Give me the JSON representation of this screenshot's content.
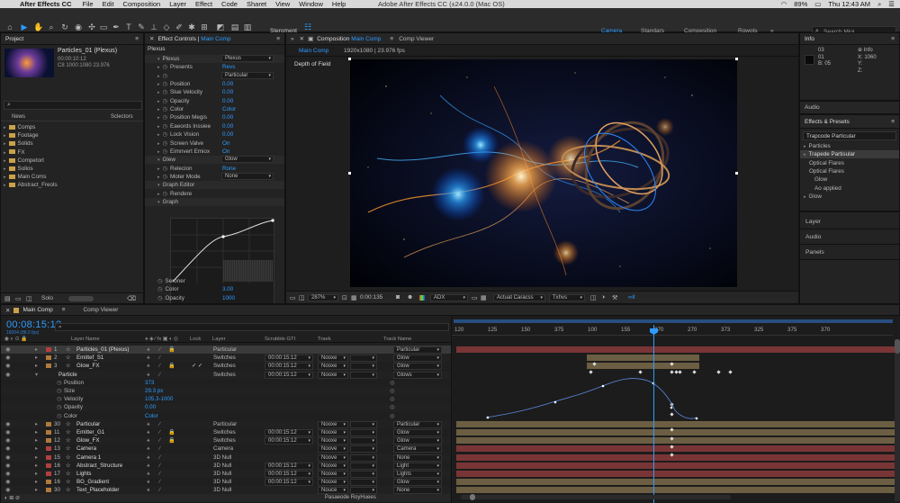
{
  "menubar": {
    "app": "After Effects CC",
    "items": [
      "File",
      "Edit",
      "Composition",
      "Layer",
      "Effect",
      "Code",
      "Sharet",
      "View",
      "Window",
      "Help"
    ],
    "center": "Adobe After Effects CC (±24.0.0 (Mac OS)",
    "battery": "89%",
    "clock": "Thu 12:43 AM"
  },
  "toolbar": {
    "storement": "Steroment",
    "workspaces": [
      "Camera",
      "Standars",
      "Compesition",
      "Rowots"
    ],
    "search": "Search Mioi"
  },
  "project": {
    "title": "Project",
    "comp_name": "Particles_01 (Plexus)",
    "comp_dur": "00:00:10:12",
    "comp_size": "C8 1000:1080 23.976",
    "col_name": "News",
    "col_sel": "Sclectors",
    "items": [
      "Comps",
      "Footage",
      "Solids",
      "FX",
      "Competort",
      "Solios",
      "Main Coms",
      "Abstract_Freols"
    ],
    "bottom_label": "Solo"
  },
  "effects": {
    "tab": "Effect Controls",
    "tab_comp": "Main Comp",
    "layer": "Plexus",
    "rows": [
      {
        "l": "Plexus",
        "v": "Plexus",
        "dd": true,
        "indent": 0
      },
      {
        "l": "Presents",
        "v": "Revs",
        "indent": 1
      },
      {
        "l": "",
        "v": "Particular",
        "dd": true,
        "indent": 1
      },
      {
        "l": "Position",
        "v": "0.00",
        "indent": 1
      },
      {
        "l": "Slue Velocity",
        "v": "0.00",
        "indent": 1
      },
      {
        "l": "Opacity",
        "v": "0.00",
        "indent": 1
      },
      {
        "l": "Color",
        "v": "Color",
        "indent": 1
      },
      {
        "l": "Position Megis",
        "v": "0.00",
        "indent": 1
      },
      {
        "l": "Eaeords Inssiee",
        "v": "0.00",
        "indent": 1
      },
      {
        "l": "Lock Vision",
        "v": "0.00",
        "indent": 1
      },
      {
        "l": "Screen Valve",
        "v": "On",
        "indent": 1
      },
      {
        "l": "Eimnvert Emiox",
        "v": "On",
        "indent": 1
      },
      {
        "l": "Glew",
        "v": "Glow",
        "dd": true,
        "indent": 0
      },
      {
        "l": "Relecion",
        "v": "Rone",
        "indent": 1
      },
      {
        "l": "Moter Mode",
        "v": "None",
        "dd": true,
        "indent": 1
      },
      {
        "l": "Graph Editor",
        "v": "",
        "indent": 0
      },
      {
        "l": "Rendere",
        "v": "",
        "indent": 1
      },
      {
        "l": "Graph",
        "v": "",
        "indent": 0
      }
    ],
    "bottom": [
      {
        "l": "Seroner",
        "v": ""
      },
      {
        "l": "Color",
        "v": "3.00"
      },
      {
        "l": "Opacity",
        "v": "1000"
      }
    ]
  },
  "comp": {
    "tab": "Composition",
    "tab_name": "Main Comp",
    "tab2": "Comp Viewer",
    "sub_tab": "Main Comp",
    "res": "1920x1080 | 23.976 fps",
    "label": "Depth of Field",
    "zoom": "287%",
    "time": "0:00:135",
    "mode": "ADX",
    "view": "Actuat Caracss",
    "views": "Txhvs",
    "extra": "∞ll"
  },
  "info": {
    "title": "Info",
    "r": "03",
    "g": "01",
    "b": "05",
    "x_label": "Info",
    "x": "1060",
    "y": "",
    "z": ""
  },
  "audio_title": "Audio",
  "presets": {
    "title": "Effects & Presets",
    "search": "Trapcode Particular",
    "items": [
      {
        "l": "Particles",
        "i": 0
      },
      {
        "l": "Trapede Partisular",
        "i": 0,
        "sel": true
      },
      {
        "l": "Optical Flares",
        "i": 1
      },
      {
        "l": "Optical Flares",
        "i": 1
      },
      {
        "l": "Glow",
        "i": 2
      },
      {
        "l": "Ao applied",
        "i": 2
      },
      {
        "l": "Glow",
        "i": 0
      }
    ]
  },
  "side_panels": [
    "Layer",
    "Audio",
    "Panels"
  ],
  "timeline": {
    "tab": "Main Comp",
    "tab2": "Comp Viewer",
    "timecode": "00:08:15:12",
    "fps": "16004 (88.0 fps)",
    "cols": [
      "Layer Name",
      "Lock",
      "Layer",
      "Scrubble GTI",
      "Traek",
      "Track Name"
    ],
    "ruler": [
      "120",
      "125",
      "150",
      "375",
      "100",
      "155",
      "370",
      "270",
      "373",
      "325",
      "375",
      "370"
    ],
    "layers": [
      {
        "n": "1",
        "name": "Particles_01 (Plexus)",
        "layer": "Particular",
        "time": "",
        "trk": "",
        "tn": "Particular",
        "color": "#b04040",
        "sel": true
      },
      {
        "n": "2",
        "name": "Emittef_S1",
        "layer": "Switches",
        "time": "00:00:15:12",
        "trk": "Nooxe",
        "tn": "Glow",
        "color": "#b07a3a"
      },
      {
        "n": "3",
        "name": "Glow_FX",
        "layer": "Switches",
        "time": "00:00:15:12",
        "trk": "Nooxe",
        "tn": "Glow",
        "color": "#b07a3a"
      },
      {
        "n": "",
        "name": "Particle",
        "layer": "Switches",
        "time": "00:00:15:12",
        "trk": "Nooxe",
        "tn": "Glows",
        "color": "",
        "sub": true
      },
      {
        "n": "",
        "name": "Position",
        "val": "373",
        "prop": true
      },
      {
        "n": "",
        "name": "Size",
        "val": "29.3 px",
        "prop": true
      },
      {
        "n": "",
        "name": "Velocity",
        "val": "105.3-1000",
        "prop": true
      },
      {
        "n": "",
        "name": "Opavity",
        "val": "0.00",
        "prop": true
      },
      {
        "n": "",
        "name": "Color",
        "val": "Color",
        "prop": true
      },
      {
        "n": "30",
        "name": "Particular",
        "layer": "Particular",
        "time": "",
        "trk": "Nooxe",
        "tn": "Particular",
        "color": "#b07a3a"
      },
      {
        "n": "11",
        "name": "Emitter_G1",
        "layer": "Switches",
        "time": "00:00:15:12",
        "trk": "Nooxe",
        "tn": "Glow",
        "color": "#b07a3a"
      },
      {
        "n": "12",
        "name": "Glow_FX",
        "layer": "Switches",
        "time": "00:00:15:12",
        "trk": "Nooxe",
        "tn": "Glow",
        "color": "#b07a3a"
      },
      {
        "n": "13",
        "name": "Camera",
        "layer": "Camera",
        "time": "",
        "trk": "Noove",
        "tn": "Camera",
        "color": "#b04040"
      },
      {
        "n": "15",
        "name": "Camera 1",
        "layer": "3D Null",
        "time": "",
        "trk": "Noove",
        "tn": "None",
        "color": "#b04040"
      },
      {
        "n": "16",
        "name": "Abstract_Structure",
        "layer": "3D Null",
        "time": "00:00:15:12",
        "trk": "Nooxe",
        "tn": "Light",
        "color": "#b04040"
      },
      {
        "n": "17",
        "name": "Lights",
        "layer": "3D Null",
        "time": "00:00:15:12",
        "trk": "Nooxe",
        "tn": "Lights",
        "color": "#b04040"
      },
      {
        "n": "16",
        "name": "BG_Gradient",
        "layer": "3D Null",
        "time": "00:00:15:12",
        "trk": "Nooxe",
        "tn": "Glow",
        "color": "#b07a3a"
      },
      {
        "n": "30",
        "name": "Text_Placeholder",
        "layer": "3D Null",
        "time": "",
        "trk": "Nouce",
        "tn": "None",
        "color": "#b07a3a"
      }
    ],
    "footer": "Pasaeode RoyHuees"
  }
}
